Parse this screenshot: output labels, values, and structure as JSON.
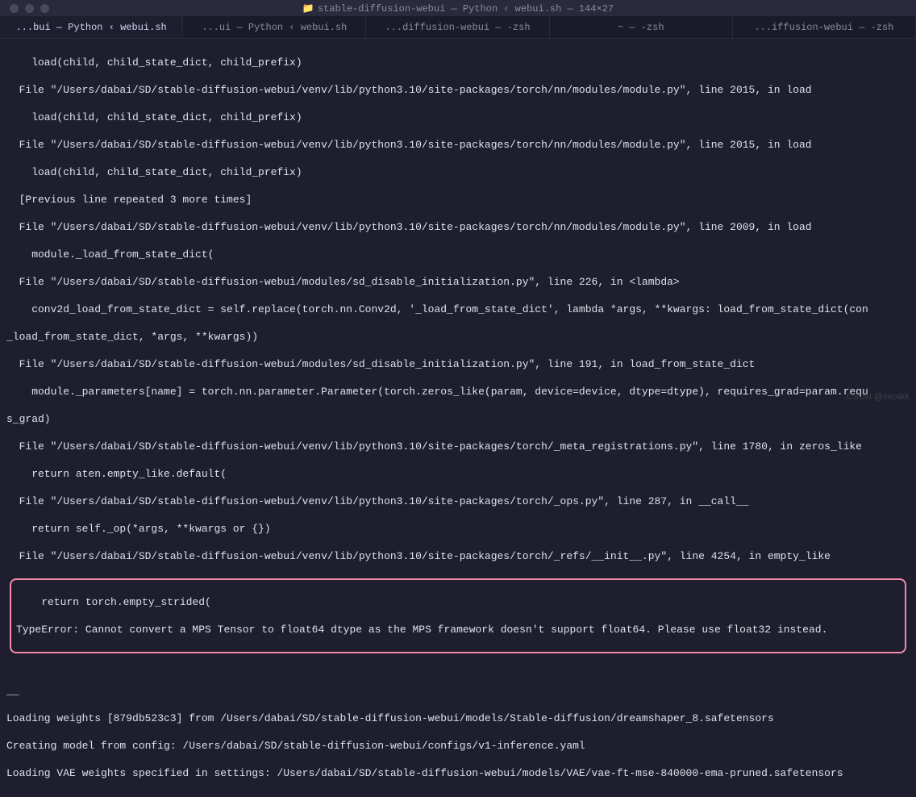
{
  "window": {
    "title": "stable-diffusion-webui — Python ‹ webui.sh — 144×27"
  },
  "tabs": [
    {
      "label": "...bui — Python ‹ webui.sh",
      "active": true
    },
    {
      "label": "...ui — Python ‹ webui.sh",
      "active": false
    },
    {
      "label": "...diffusion-webui — -zsh",
      "active": false
    },
    {
      "label": "~ — -zsh",
      "active": false
    },
    {
      "label": "...iffusion-webui — -zsh",
      "active": false
    }
  ],
  "terminal": {
    "lines": [
      "    load(child, child_state_dict, child_prefix)",
      "  File \"/Users/dabai/SD/stable-diffusion-webui/venv/lib/python3.10/site-packages/torch/nn/modules/module.py\", line 2015, in load",
      "    load(child, child_state_dict, child_prefix)",
      "  File \"/Users/dabai/SD/stable-diffusion-webui/venv/lib/python3.10/site-packages/torch/nn/modules/module.py\", line 2015, in load",
      "    load(child, child_state_dict, child_prefix)",
      "  [Previous line repeated 3 more times]",
      "  File \"/Users/dabai/SD/stable-diffusion-webui/venv/lib/python3.10/site-packages/torch/nn/modules/module.py\", line 2009, in load",
      "    module._load_from_state_dict(",
      "  File \"/Users/dabai/SD/stable-diffusion-webui/modules/sd_disable_initialization.py\", line 226, in <lambda>",
      "    conv2d_load_from_state_dict = self.replace(torch.nn.Conv2d, '_load_from_state_dict', lambda *args, **kwargs: load_from_state_dict(con",
      "_load_from_state_dict, *args, **kwargs))",
      "  File \"/Users/dabai/SD/stable-diffusion-webui/modules/sd_disable_initialization.py\", line 191, in load_from_state_dict",
      "    module._parameters[name] = torch.nn.parameter.Parameter(torch.zeros_like(param, device=device, dtype=dtype), requires_grad=param.requ",
      "s_grad)",
      "  File \"/Users/dabai/SD/stable-diffusion-webui/venv/lib/python3.10/site-packages/torch/_meta_registrations.py\", line 1780, in zeros_like",
      "    return aten.empty_like.default(",
      "  File \"/Users/dabai/SD/stable-diffusion-webui/venv/lib/python3.10/site-packages/torch/_ops.py\", line 287, in __call__",
      "    return self._op(*args, **kwargs or {})",
      "  File \"/Users/dabai/SD/stable-diffusion-webui/venv/lib/python3.10/site-packages/torch/_refs/__init__.py\", line 4254, in empty_like"
    ],
    "highlighted": [
      "    return torch.empty_strided(",
      "TypeError: Cannot convert a MPS Tensor to float64 dtype as the MPS framework doesn't support float64. Please use float32 instead."
    ],
    "after": [
      "",
      "__",
      "Loading weights [879db523c3] from /Users/dabai/SD/stable-diffusion-webui/models/Stable-diffusion/dreamshaper_8.safetensors",
      "Creating model from config: /Users/dabai/SD/stable-diffusion-webui/configs/v1-inference.yaml",
      "Loading VAE weights specified in settings: /Users/dabai/SD/stable-diffusion-webui/models/VAE/vae-ft-mse-840000-ema-pruned.safetensors"
    ]
  },
  "watermark": "CSDN @xiexikk"
}
